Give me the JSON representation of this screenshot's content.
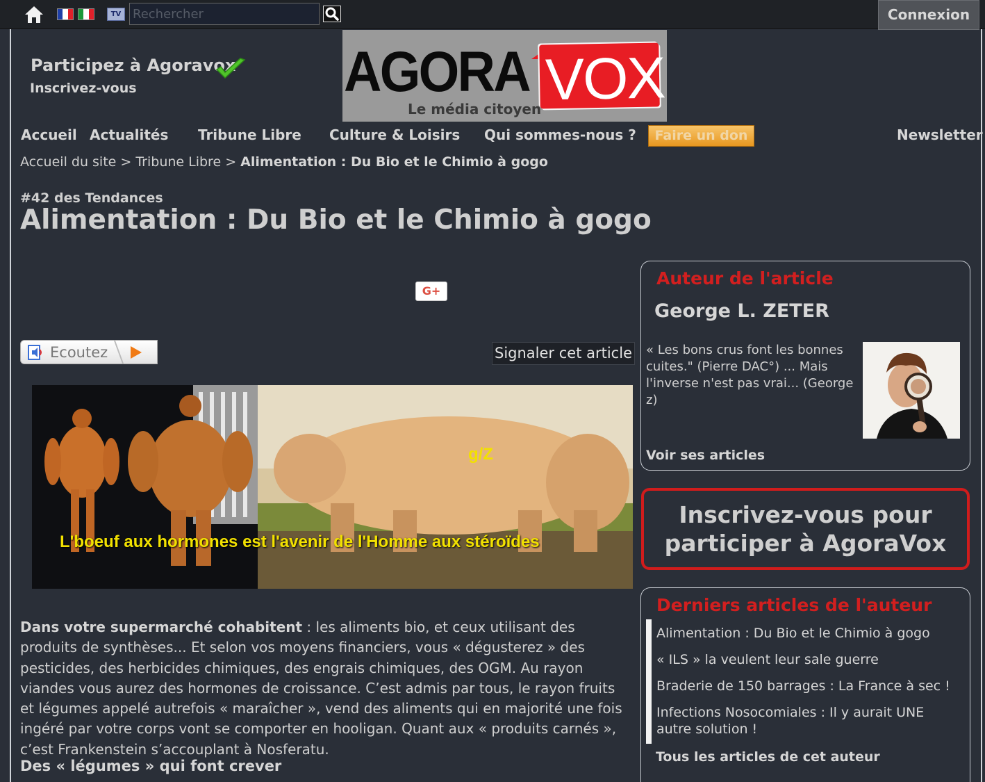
{
  "topbar": {
    "search_placeholder": "Rechercher",
    "tv_label": "TV",
    "login_label": "Connexion"
  },
  "header": {
    "participate": "Participez à Agoravox",
    "signup_link": "Inscrivez-vous",
    "logo_agora": "AGORA",
    "logo_vox": "VOX",
    "logo_tagline": "Le média citoyen"
  },
  "nav": {
    "items": [
      "Accueil",
      "Actualités",
      "Tribune Libre",
      "Culture & Loisirs",
      "Qui sommes-nous ?"
    ],
    "donate": "Faire un don",
    "newsletter": "Newsletter"
  },
  "breadcrumb": {
    "home": "Accueil du site",
    "section": "Tribune Libre",
    "current": "Alimentation : Du Bio et le Chimio à gogo",
    "separator": ">"
  },
  "article": {
    "trend": "#42 des Tendances",
    "title": "Alimentation : Du Bio et le Chimio à gogo",
    "gplus": "G+",
    "listen_label": "Ecoutez",
    "report_label": "Signaler cet article",
    "image_caption": "L'boeuf aux hormones est l'avenir de l'Homme aux stéroïdes",
    "image_mark": "g/Z",
    "lead_bold": "Dans votre supermarché cohabitent",
    "lead_text": " : les aliments bio, et ceux utilisant des produits de synthèses... Et selon vos moyens financiers, vous « dégusterez » des pesticides, des herbicides chimiques, des engrais chimiques, des OGM. Au rayon viandes vous aurez des hormones de croissance. C’est admis par tous, le rayon fruits et légumes appelé autrefois « maraîcher », vend des aliments qui en majorité une fois ingéré par votre corps vont se comporter en hooligan. Quant aux « produits carnés », c’est Frankenstein s’accouplant à Nosferatu.",
    "subhead": "Des « légumes » qui font crever"
  },
  "sidebar": {
    "author_title": "Auteur de l'article",
    "author_name": "George L. ZETER",
    "author_quote": "« Les bons crus font les bonnes cuites.\" (Pierre DAC°) ... Mais l'inverse n'est pas vrai... (George z)",
    "see_articles": "Voir ses articles",
    "signup_cta": "Inscrivez-vous pour participer à AgoraVox",
    "latest_title": "Derniers articles de l'auteur",
    "latest_items": [
      "Alimentation : Du Bio et le Chimio à gogo",
      "« ILS » la veulent leur sale guerre",
      "Braderie de 150 barrages : La France à sec !",
      "Infections Nosocomiales : Il y aurait UNE autre solution !"
    ],
    "all_articles": "Tous les articles de cet auteur"
  },
  "colors": {
    "background": "#2a2f38",
    "accent_red": "#d21f1f",
    "donate_orange": "#e89820",
    "caption_yellow": "#f2e100"
  },
  "icons": [
    "home-icon",
    "flag-fr-icon",
    "flag-it-icon",
    "tv-icon",
    "search-icon",
    "check-icon",
    "speaker-icon",
    "play-icon"
  ]
}
